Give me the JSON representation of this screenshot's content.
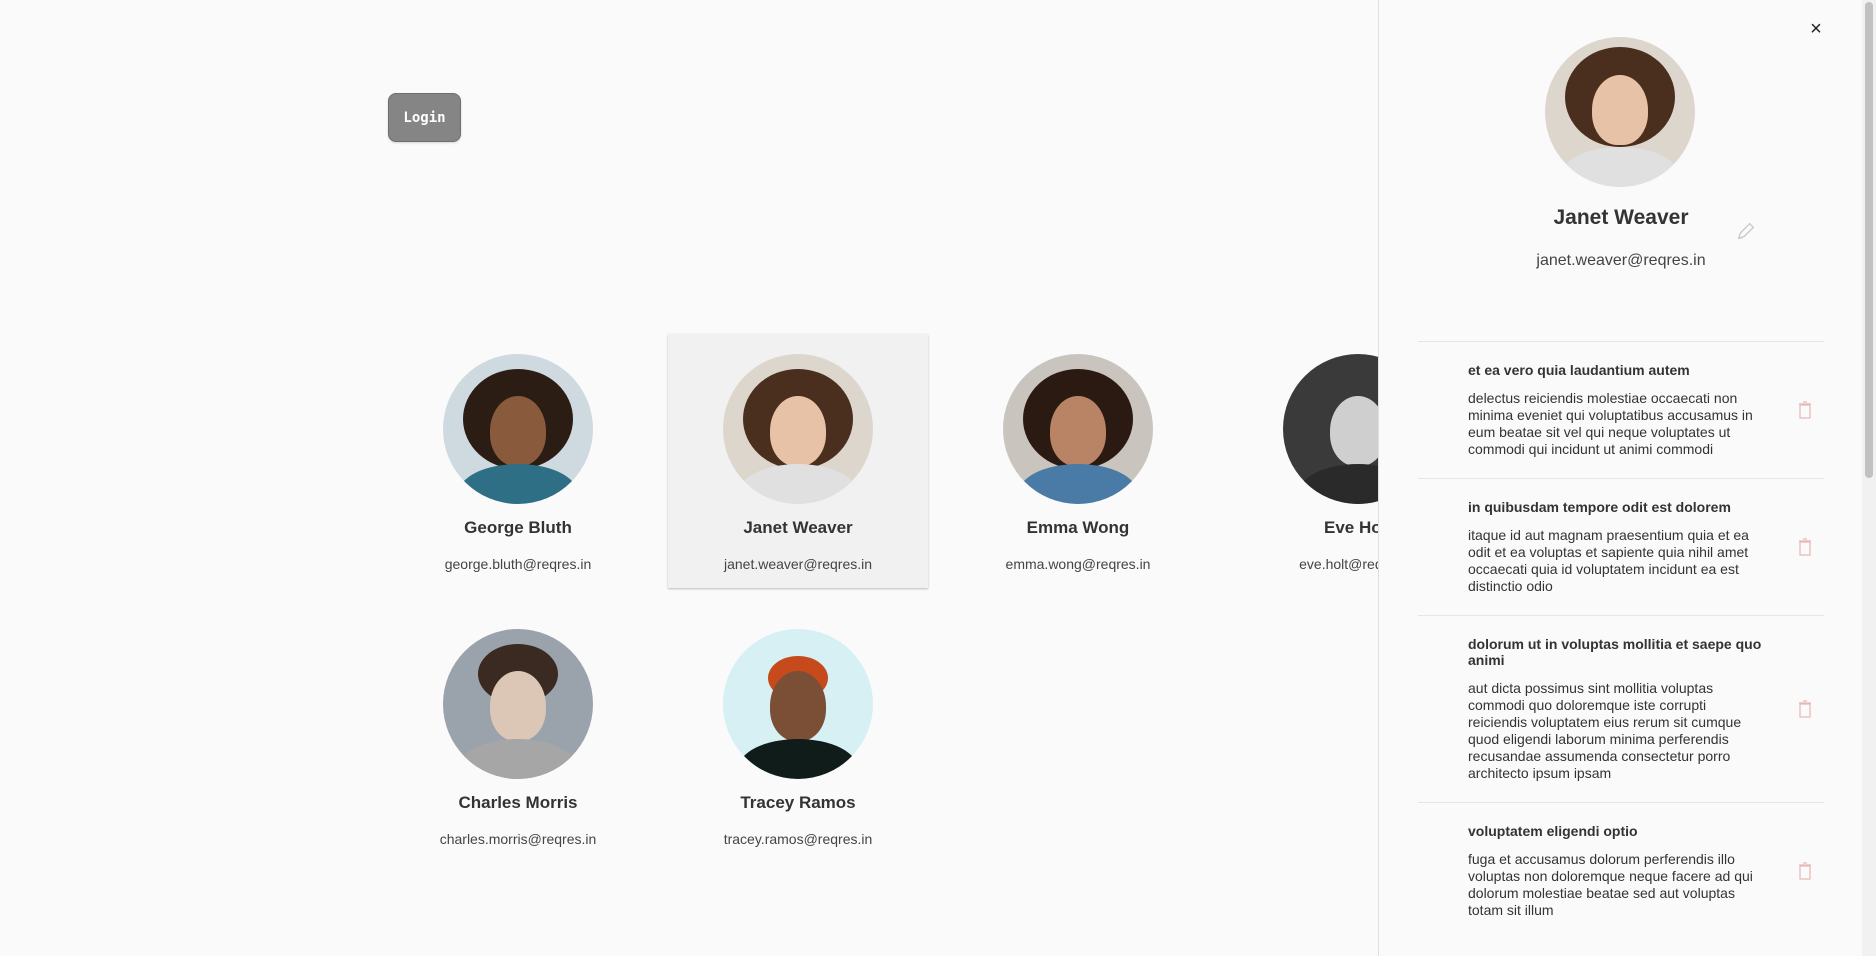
{
  "header": {
    "login_label": "Login"
  },
  "users": [
    {
      "name": "George Bluth",
      "email": "george.bluth@reqres.in",
      "skin": "#8a5a3c",
      "hair": "#2b1d14",
      "body": "#2f6f86",
      "bg": "#cfd9e0"
    },
    {
      "name": "Janet Weaver",
      "email": "janet.weaver@reqres.in",
      "skin": "#e8c2a6",
      "hair": "#4a2e1e",
      "body": "#e0e0e0",
      "bg": "#ddd6cc"
    },
    {
      "name": "Emma Wong",
      "email": "emma.wong@reqres.in",
      "skin": "#b98466",
      "hair": "#2a1a12",
      "body": "#4a7aa6",
      "bg": "#c9c4bd"
    },
    {
      "name": "Eve Holt",
      "email": "eve.holt@reqres.in",
      "skin": "#cfcfcf",
      "hair": "#1a1a1a",
      "body": "#2a2a2a",
      "bg": "#3a3a3a"
    },
    {
      "name": "Charles Morris",
      "email": "charles.morris@reqres.in",
      "skin": "#dcc7b6",
      "hair": "#3a2a22",
      "body": "#a6a6a6",
      "bg": "#9aa3ab"
    },
    {
      "name": "Tracey Ramos",
      "email": "tracey.ramos@reqres.in",
      "skin": "#7a4f35",
      "hair": "#c64a1c",
      "body": "#0f1c1a",
      "bg": "#d6f0f4"
    }
  ],
  "panel": {
    "close_label": "×",
    "name": "Janet Weaver",
    "email": "janet.weaver@reqres.in",
    "posts": [
      {
        "title": "et ea vero quia laudantium autem",
        "body": "delectus reiciendis molestiae occaecati non minima eveniet qui voluptatibus accusamus in eum beatae sit vel qui neque voluptates ut commodi qui incidunt ut animi commodi"
      },
      {
        "title": "in quibusdam tempore odit est dolorem",
        "body": "itaque id aut magnam praesentium quia et ea odit et ea voluptas et sapiente quia nihil amet occaecati quia id voluptatem incidunt ea est distinctio odio"
      },
      {
        "title": "dolorum ut in voluptas mollitia et saepe quo animi",
        "body": "aut dicta possimus sint mollitia voluptas commodi quo doloremque iste corrupti reiciendis voluptatem eius rerum sit cumque quod eligendi laborum minima perferendis recusandae assumenda consectetur porro architecto ipsum ipsam"
      },
      {
        "title": "voluptatem eligendi optio",
        "body": "fuga et accusamus dolorum perferendis illo voluptas non doloremque neque facere ad qui dolorum molestiae beatae sed aut voluptas totam sit illum"
      }
    ]
  },
  "colors": {
    "accent": "#858585",
    "selected_card": "#f1f1f1"
  }
}
